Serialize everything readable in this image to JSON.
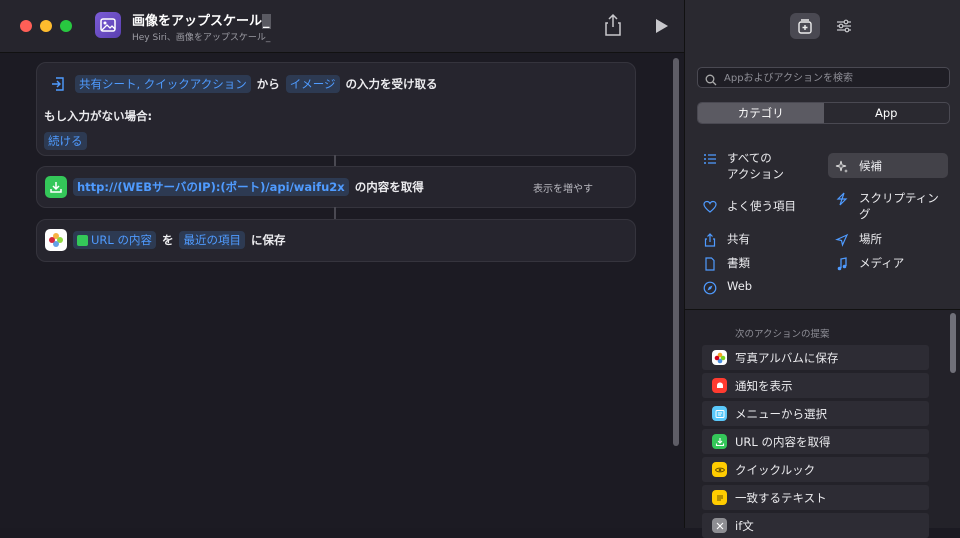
{
  "window": {
    "title": "画像をアップスケール",
    "title_suffix": "_",
    "subtitle": "Hey Siri、画像をアップスケール_"
  },
  "workflow": {
    "step1": {
      "input_types": "共有シート, クイックアクション",
      "from_label": "から",
      "content_type": "イメージ",
      "receive_label": "の入力を受け取る",
      "if_no_input_label": "もし入力がない場合:",
      "fallback_action": "続ける"
    },
    "step2": {
      "url": "http://(WEBサーバのIP):(ポート)/api/waifu2x",
      "suffix": "の内容を取得",
      "show_more": "表示を増やす"
    },
    "step3": {
      "input_var": "URL の内容",
      "particle": "を",
      "album": "最近の項目",
      "suffix": "に保存"
    }
  },
  "sidebar": {
    "search_placeholder": "Appおよびアクションを検索",
    "segments": [
      "カテゴリ",
      "App"
    ],
    "selected_segment": "カテゴリ",
    "categories": [
      {
        "label": "すべての\nアクション",
        "icon": "list-icon"
      },
      {
        "label": "候補",
        "icon": "sparkle-icon",
        "selected": true
      },
      {
        "label": "よく使う項目",
        "icon": "heart-icon"
      },
      {
        "label": "スクリプティン\nグ",
        "icon": "scripting-icon"
      },
      {
        "label": "共有",
        "icon": "share-icon"
      },
      {
        "label": "場所",
        "icon": "location-arrow-icon"
      },
      {
        "label": "書類",
        "icon": "document-icon"
      },
      {
        "label": "メディア",
        "icon": "music-note-icon"
      },
      {
        "label": "Web",
        "icon": "compass-icon"
      }
    ],
    "suggestions_header": "次のアクションの提案",
    "suggestions": [
      {
        "label": "写真アルバムに保存",
        "icon": "photos-icon"
      },
      {
        "label": "通知を表示",
        "icon": "notification-icon",
        "color": "#ff3b30"
      },
      {
        "label": "メニューから選択",
        "icon": "menu-icon",
        "color": "#5ac8fa"
      },
      {
        "label": "URL の内容を取得",
        "icon": "download-icon",
        "color": "#34c759"
      },
      {
        "label": "クイックルック",
        "icon": "eye-icon",
        "color": "#ffcc00"
      },
      {
        "label": "一致するテキスト",
        "icon": "text-icon",
        "color": "#ffcc00"
      },
      {
        "label": "if文",
        "icon": "if-icon",
        "color": "#8e8e93"
      }
    ]
  },
  "colors": {
    "accent": "#4f9bff",
    "token_bg": "#2d3a52",
    "green": "#34c759"
  }
}
